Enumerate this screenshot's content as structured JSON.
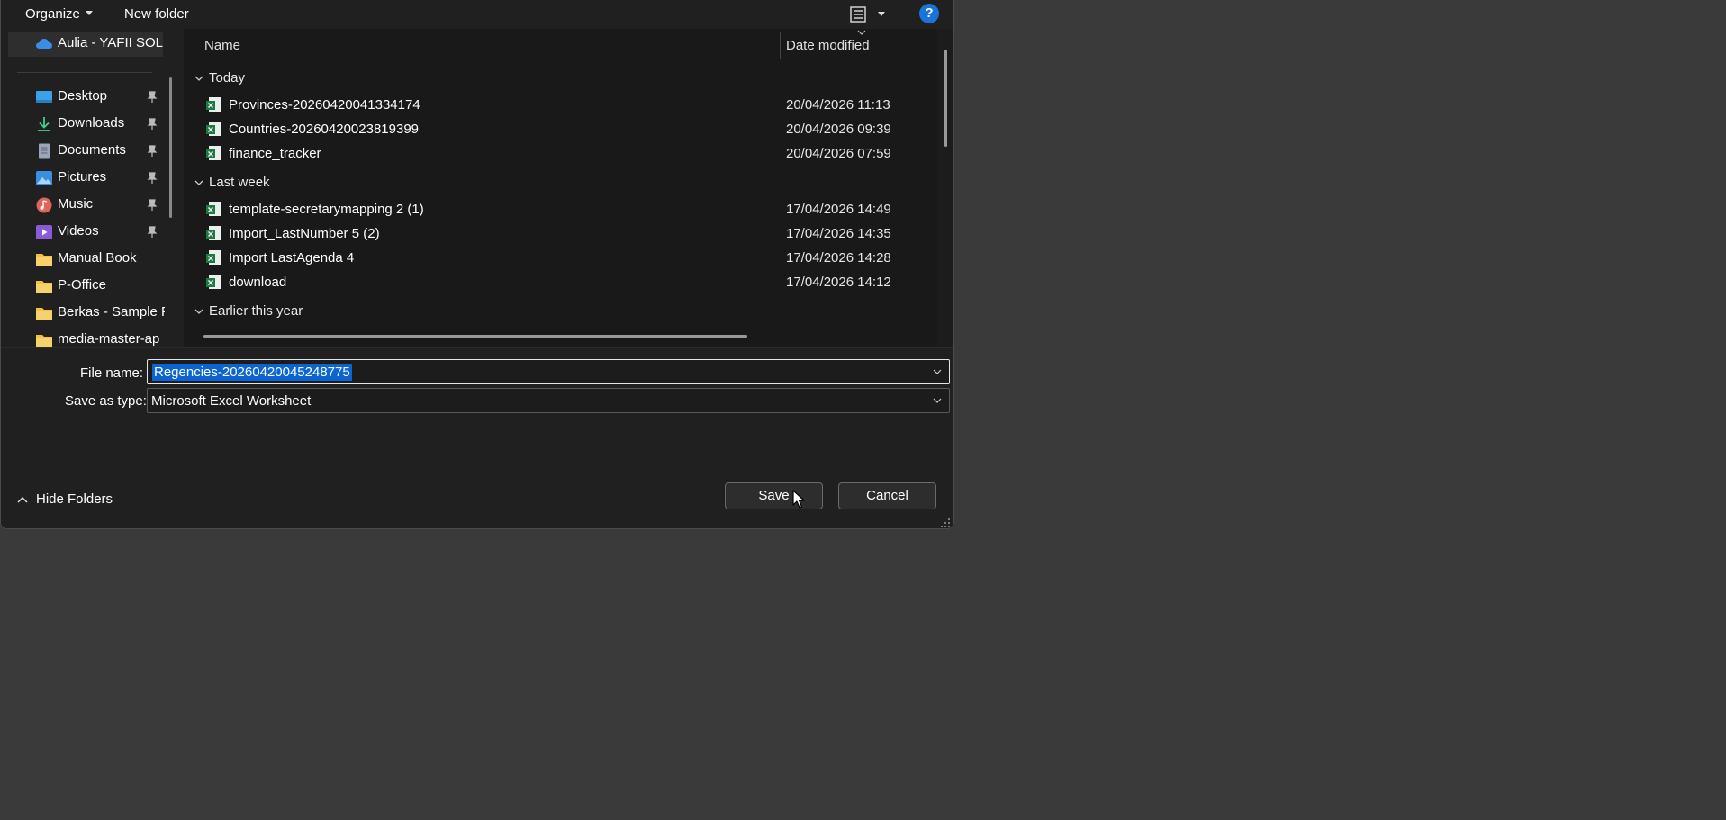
{
  "toolbar": {
    "organize_label": "Organize",
    "new_folder_label": "New folder",
    "view_icon": "list-view-icon",
    "help_label": "?"
  },
  "nav": {
    "items": [
      {
        "label": "Aulia - YAFII SOLU",
        "icon": "cloud-icon",
        "pinned": false,
        "selected": true
      },
      {
        "label": "Desktop",
        "icon": "desktop-icon",
        "pinned": true
      },
      {
        "label": "Downloads",
        "icon": "download-icon",
        "pinned": true
      },
      {
        "label": "Documents",
        "icon": "documents-icon",
        "pinned": true
      },
      {
        "label": "Pictures",
        "icon": "pictures-icon",
        "pinned": true
      },
      {
        "label": "Music",
        "icon": "music-icon",
        "pinned": true
      },
      {
        "label": "Videos",
        "icon": "videos-icon",
        "pinned": true
      },
      {
        "label": "Manual Book",
        "icon": "folder-icon",
        "pinned": false
      },
      {
        "label": "P-Office",
        "icon": "folder-icon",
        "pinned": false
      },
      {
        "label": "Berkas - Sample F",
        "icon": "folder-icon",
        "pinned": false
      },
      {
        "label": "media-master-ap",
        "icon": "folder-icon",
        "pinned": false
      }
    ]
  },
  "file_list": {
    "col_name": "Name",
    "col_date": "Date modified",
    "groups": [
      {
        "label": "Today",
        "files": [
          {
            "name": "Provinces-20260420041334174",
            "date": "20/04/2026 11:13"
          },
          {
            "name": "Countries-20260420023819399",
            "date": "20/04/2026 09:39"
          },
          {
            "name": "finance_tracker",
            "date": "20/04/2026 07:59"
          }
        ]
      },
      {
        "label": "Last week",
        "files": [
          {
            "name": "template-secretarymapping 2 (1)",
            "date": "17/04/2026 14:49"
          },
          {
            "name": "Import_LastNumber 5 (2)",
            "date": "17/04/2026 14:35"
          },
          {
            "name": "Import LastAgenda 4",
            "date": "17/04/2026 14:28"
          },
          {
            "name": "download",
            "date": "17/04/2026 14:12"
          }
        ]
      },
      {
        "label": "Earlier this year",
        "files": []
      }
    ]
  },
  "form": {
    "file_name_label": "File name:",
    "file_name_value": "Regencies-20260420045248775",
    "save_type_label": "Save as type:",
    "save_type_value": "Microsoft Excel Worksheet"
  },
  "footer": {
    "hide_folders_label": "Hide Folders",
    "save_label": "Save",
    "cancel_label": "Cancel"
  },
  "colors": {
    "accent": "#0a64d2",
    "dialog_bg": "#202020",
    "desktop_bg": "#3a3a3a",
    "excel_green": "#1d7a45"
  }
}
